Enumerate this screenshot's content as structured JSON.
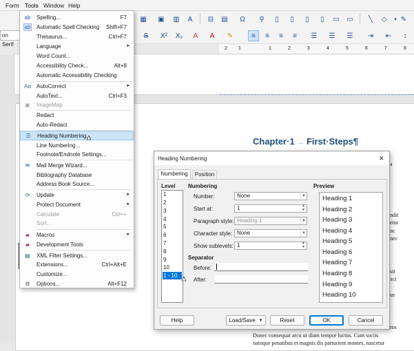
{
  "menubar": {
    "items": [
      "Form",
      "Tools",
      "Window",
      "Help"
    ]
  },
  "toolbar": {
    "font_name_fragment": "on Serif"
  },
  "tools_menu": {
    "items": [
      {
        "label": "Spelling...",
        "shortcut": "F7",
        "icon": "spelling-icon"
      },
      {
        "label": "Automatic Spell Checking",
        "shortcut": "Shift+F7",
        "icon": "auto-spellcheck-icon"
      },
      {
        "label": "Thesaurus...",
        "shortcut": "Ctrl+F7"
      },
      {
        "label": "Language",
        "submenu": true
      },
      {
        "label": "Word Count..."
      },
      {
        "label": "Accessibility Check...",
        "shortcut": "Alt+8"
      },
      {
        "label": "Automatic Accessibility Checking"
      },
      {
        "label": "AutoCorrect",
        "submenu": true,
        "icon": "autocorrect-icon"
      },
      {
        "label": "AutoText...",
        "shortcut": "Ctrl+F3"
      },
      {
        "label": "ImageMap",
        "disabled": true,
        "icon": "imagemap-icon"
      },
      {
        "label": "Redact"
      },
      {
        "label": "Auto-Redact"
      },
      {
        "label": "Heading Numbering...",
        "highlighted": true,
        "icon": "heading-numbering-icon"
      },
      {
        "label": "Line Numbering..."
      },
      {
        "label": "Footnote/Endnote Settings..."
      },
      {
        "label": "Mail Merge Wizard...",
        "icon": "mail-merge-icon"
      },
      {
        "label": "Bibliography Database"
      },
      {
        "label": "Address Book Source..."
      },
      {
        "label": "Update",
        "submenu": true,
        "icon": "update-icon"
      },
      {
        "label": "Protect Document",
        "submenu": true
      },
      {
        "label": "Calculate",
        "shortcut": "Ctrl++",
        "disabled": true
      },
      {
        "label": "Sort...",
        "disabled": true
      },
      {
        "label": "Macros",
        "submenu": true,
        "icon": "macros-icon"
      },
      {
        "label": "Development Tools",
        "icon": "dev-tools-icon"
      },
      {
        "label": "XML Filter Settings...",
        "icon": "xml-filter-icon"
      },
      {
        "label": "Extensions...",
        "shortcut": "Ctrl+Alt+E"
      },
      {
        "label": "Customize..."
      },
      {
        "label": "Options...",
        "shortcut": "Alt+F12",
        "icon": "options-gear-icon"
      }
    ]
  },
  "document": {
    "ruler_numbers": [
      "2",
      "1",
      "1",
      "2",
      "3",
      "4",
      "5",
      "6",
      "7",
      "8"
    ],
    "heading_prefix": "Chapter·1",
    "heading_arrow": "→",
    "heading_title": "First·Steps¶",
    "big_text_fragment": "p",
    "bottom_line_1": "Donec consequat arcu ut diam tempor luctus. Cum sociis",
    "bottom_line_2": "natoque penatibus et magnis dis parturient montes, nascetur",
    "right_fragments": [
      "a",
      "ndit",
      "etur",
      "nc",
      "nec",
      "sit",
      "xci",
      "us",
      "ros"
    ]
  },
  "dialog": {
    "title": "Heading Numbering",
    "close_glyph": "✕",
    "tabs": [
      "Numbering",
      "Position"
    ],
    "active_tab": 0,
    "level_header": "Level",
    "levels": [
      "1",
      "2",
      "3",
      "4",
      "5",
      "6",
      "7",
      "8",
      "9",
      "10",
      "1 - 10"
    ],
    "selected_level_index": 10,
    "numbering_header": "Numbering",
    "number_label": "Number:",
    "number_value": "None",
    "start_at_label": "Start at:",
    "start_at_value": "1",
    "paragraph_style_label": "Paragraph style:",
    "paragraph_style_value": "Heading 1",
    "character_style_label": "Character style:",
    "character_style_value": "None",
    "show_sublevels_label": "Show sublevels:",
    "show_sublevels_value": "1",
    "separator_header": "Separator",
    "before_label": "Before:",
    "before_value": "",
    "after_label": "After:",
    "after_value": "",
    "preview_header": "Preview",
    "preview_items": [
      "Heading 1",
      "Heading 2",
      "Heading 3",
      "Heading 4",
      "Heading 5",
      "Heading 6",
      "Heading 7",
      "Heading 8",
      "Heading 9",
      "Heading 10"
    ],
    "buttons": {
      "help": "Help",
      "load_save": "Load/Save",
      "reset": "Reset",
      "ok": "OK",
      "cancel": "Cancel"
    }
  },
  "colors": {
    "accent": "#0078d7",
    "menu_highlight": "#cce4f7",
    "heading_text": "#1f4e79"
  }
}
